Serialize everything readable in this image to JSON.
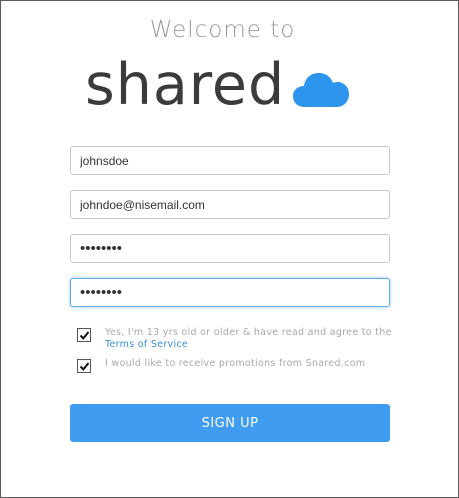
{
  "header": {
    "welcome_text": "Welcome to",
    "logo_text": "shared",
    "cloud_icon": "cloud-icon",
    "cloud_color": "#2d95ee"
  },
  "form": {
    "username_value": "johnsdoe",
    "email_value": "johndoe@nisemail.com",
    "password_value": "••••••••",
    "confirm_password_value": "••••••••"
  },
  "agreements": {
    "terms_text_before": "Yes, I'm 13 yrs old or older & have read and agree to the ",
    "terms_link": "Terms of Service",
    "terms_checked": true,
    "promo_text": "I would like to receive promotions from Snared.com",
    "promo_checked": true,
    "check_icon": "checkmark-icon"
  },
  "actions": {
    "signup_label": "SIGN UP",
    "accent_color": "#3f9cf1"
  }
}
